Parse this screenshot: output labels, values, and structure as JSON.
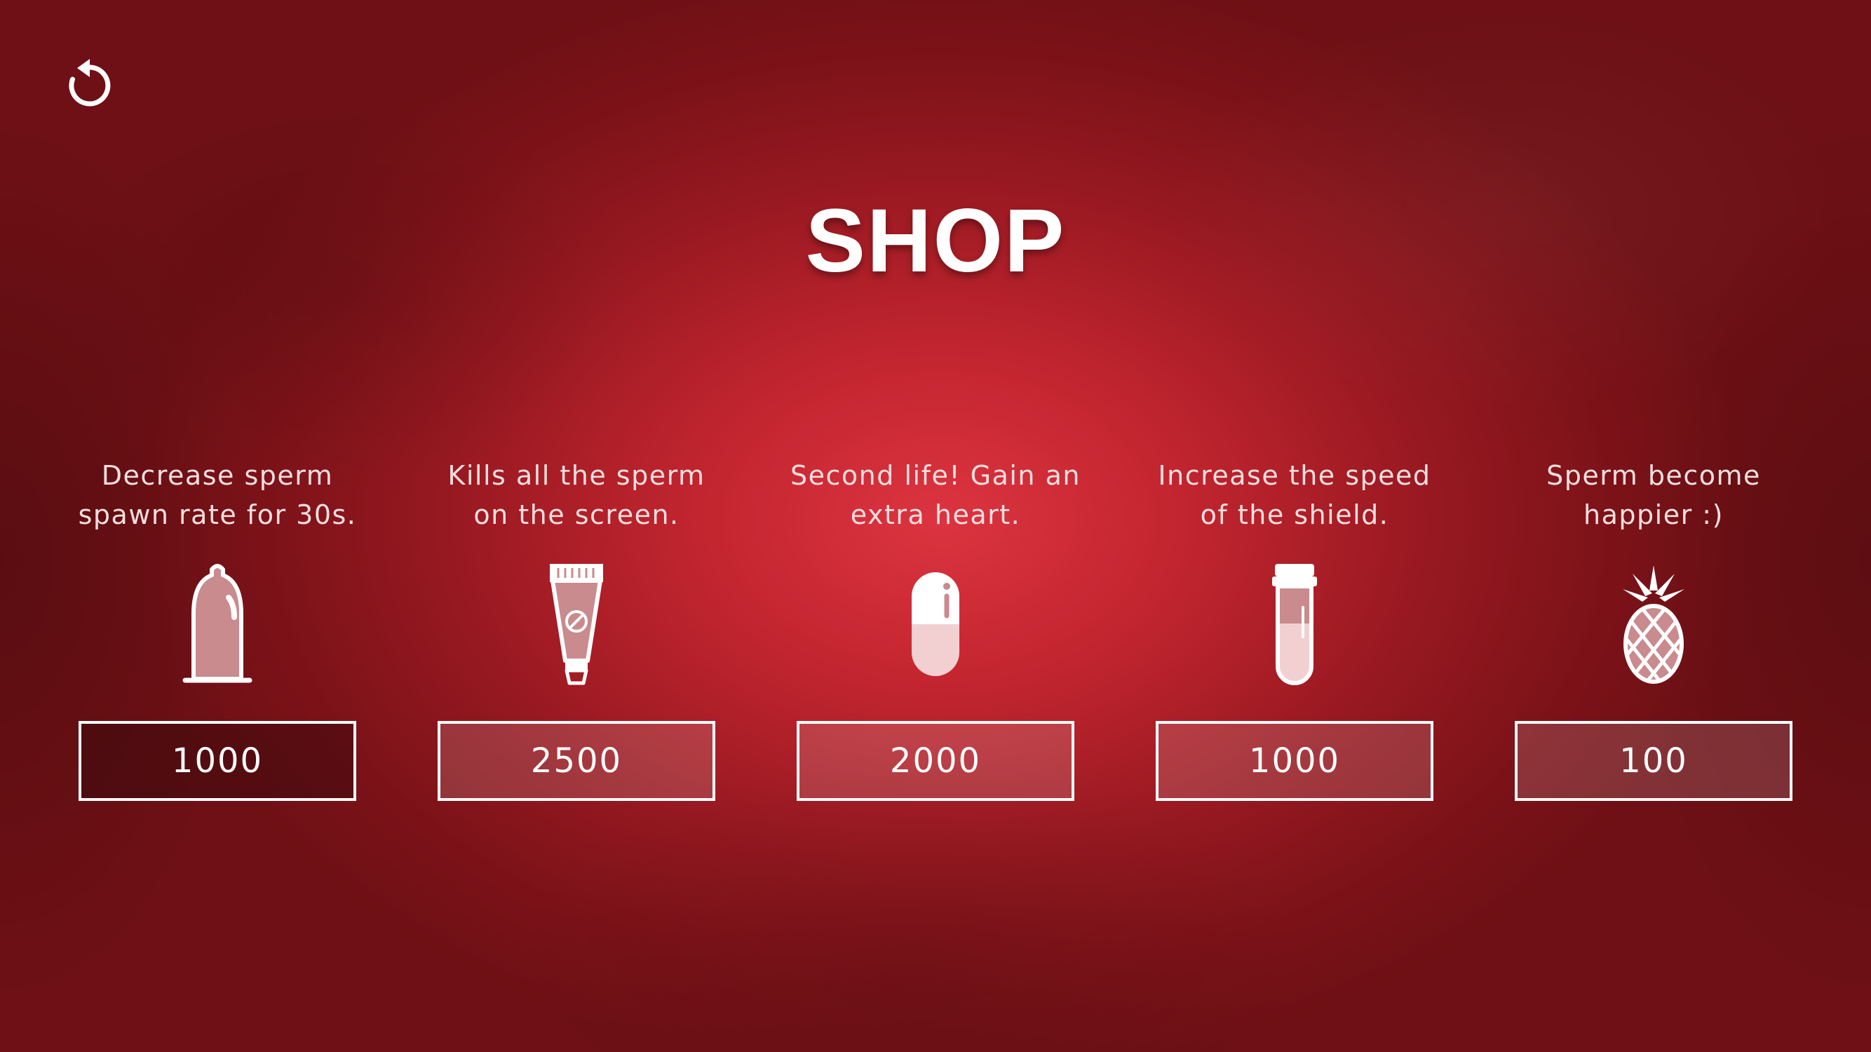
{
  "screen": {
    "title": "SHOP",
    "back_icon": "undo-arrow-icon"
  },
  "colors": {
    "background_center": "#dc3440",
    "background_edge": "#6e1015",
    "text": "#ffffff",
    "icon_fill": "#c98b8e"
  },
  "items": [
    {
      "description": "Decrease sperm spawn rate for 30s.",
      "price": "1000",
      "icon": "condom-icon"
    },
    {
      "description": "Kills all the sperm on the screen.",
      "price": "2500",
      "icon": "tube-icon"
    },
    {
      "description": "Second life! Gain an extra heart.",
      "price": "2000",
      "icon": "pill-icon"
    },
    {
      "description": "Increase the speed of the shield.",
      "price": "1000",
      "icon": "test-tube-icon"
    },
    {
      "description": "Sperm become happier :)",
      "price": "100",
      "icon": "pineapple-icon"
    }
  ]
}
